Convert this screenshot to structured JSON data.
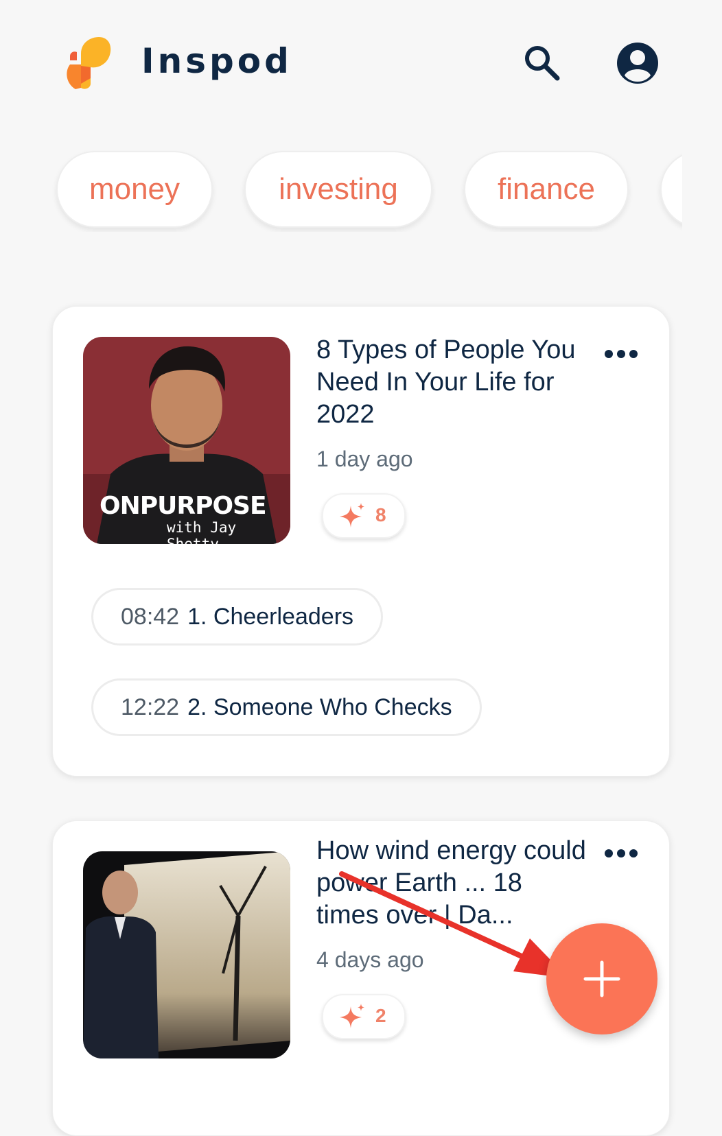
{
  "app": {
    "name": "Inspod"
  },
  "header": {
    "search_icon": "search-icon",
    "account_icon": "account-icon"
  },
  "tags": [
    "money",
    "investing",
    "finance"
  ],
  "episodes": [
    {
      "title": "8 Types of People You Need In Your Life for 2022",
      "age": "1 day ago",
      "sparkles": "8",
      "podcast_logo_text": "ONPURPOSE",
      "podcast_logo_subtext": "with Jay Shetty",
      "chapters": [
        {
          "time": "08:42",
          "title": "1. Cheerleaders"
        },
        {
          "time": "12:22",
          "title": "2. Someone Who Checks"
        }
      ]
    },
    {
      "title": "How wind energy could power Earth ... 18 times over | Da...",
      "age": "4 days ago",
      "sparkles": "2"
    }
  ],
  "colors": {
    "accent": "#fb7456",
    "text": "#0f2743",
    "tag_text": "#ec7257",
    "annotation_arrow": "#e8322a"
  },
  "fab": {
    "icon": "plus-icon"
  }
}
